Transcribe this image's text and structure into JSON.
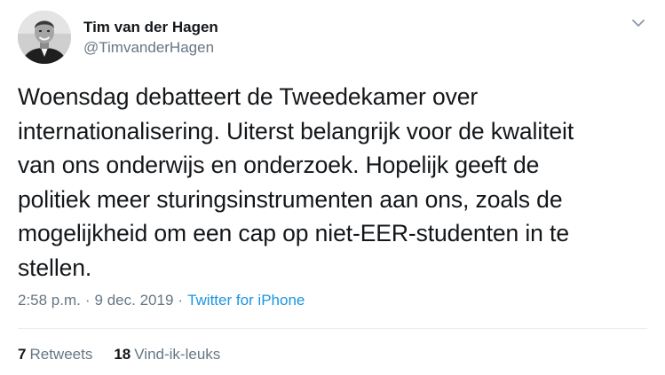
{
  "author": {
    "display_name": "Tim van der Hagen",
    "handle": "@TimvanderHagen",
    "avatar_icon": "profile-photo"
  },
  "tweet": {
    "text": "Woensdag debatteert de Tweedekamer over\ninternationalisering. Uiterst belangrijk voor de kwaliteit\nvan ons onderwijs en onderzoek. Hopelijk geeft de\npolitiek meer sturingsinstrumenten aan ons, zoals de\nmogelijkheid om een cap op niet-EER-studenten in te\nstellen."
  },
  "meta": {
    "time": "2:58 p.m.",
    "separator": "·",
    "date": "9 dec. 2019",
    "source": "Twitter for iPhone"
  },
  "stats": {
    "retweets_count": "7",
    "retweets_label": "Retweets",
    "likes_count": "18",
    "likes_label": "Vind-ik-leuks"
  },
  "colors": {
    "text": "#14171a",
    "secondary": "#657786",
    "link": "#1b95e0",
    "divider": "#e6ecf0"
  }
}
